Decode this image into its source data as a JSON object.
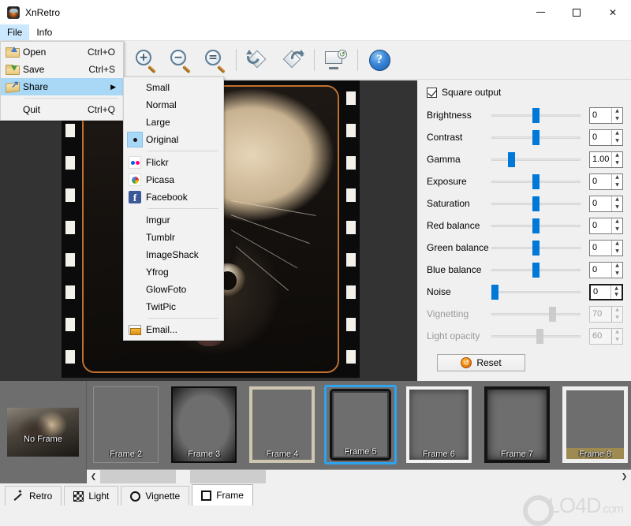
{
  "window": {
    "title": "XnRetro",
    "icon": "app-icon",
    "controls": {
      "minimize": "–",
      "maximize": "☐",
      "close": "✕"
    }
  },
  "menubar": {
    "items": [
      {
        "label": "File",
        "active": true
      },
      {
        "label": "Info",
        "active": false
      }
    ]
  },
  "file_menu": {
    "items": [
      {
        "label": "Open",
        "accel": "Ctrl+O",
        "icon": "folder-open-icon",
        "selected": false,
        "submenu": false
      },
      {
        "label": "Save",
        "accel": "Ctrl+S",
        "icon": "folder-save-icon",
        "selected": false,
        "submenu": false
      },
      {
        "label": "Share",
        "accel": "",
        "icon": "share-icon",
        "selected": true,
        "submenu": true,
        "arrow": "▶"
      },
      {
        "label": "Quit",
        "accel": "Ctrl+Q",
        "icon": "",
        "selected": false,
        "submenu": false
      }
    ]
  },
  "share_menu": {
    "sizes": [
      {
        "label": "Small",
        "checked": false
      },
      {
        "label": "Normal",
        "checked": false
      },
      {
        "label": "Large",
        "checked": false
      },
      {
        "label": "Original",
        "checked": true
      }
    ],
    "services_primary": [
      {
        "label": "Flickr",
        "icon": "flickr-icon"
      },
      {
        "label": "Picasa",
        "icon": "picasa-icon"
      },
      {
        "label": "Facebook",
        "icon": "facebook-icon"
      }
    ],
    "services_secondary": [
      {
        "label": "Imgur"
      },
      {
        "label": "Tumblr"
      },
      {
        "label": "ImageShack"
      },
      {
        "label": "Yfrog"
      },
      {
        "label": "GlowFoto"
      },
      {
        "label": "TwitPic"
      }
    ],
    "email": {
      "label": "Email...",
      "icon": "email-icon"
    }
  },
  "toolbar": {
    "buttons": [
      {
        "name": "zoom-in-icon",
        "symbol": "+"
      },
      {
        "name": "zoom-out-icon",
        "symbol": "−"
      },
      {
        "name": "zoom-fit-icon",
        "symbol": "="
      },
      {
        "name": "rotate-right-icon",
        "symbol": ""
      },
      {
        "name": "rotate-left-icon",
        "symbol": ""
      },
      {
        "name": "restore-view-icon",
        "symbol": "↺"
      },
      {
        "name": "help-icon",
        "symbol": "?"
      }
    ]
  },
  "panel": {
    "square_output": {
      "label": "Square output",
      "checked": true
    },
    "sliders": [
      {
        "label": "Brightness",
        "value": "0",
        "pos": 50,
        "enabled": true
      },
      {
        "label": "Contrast",
        "value": "0",
        "pos": 50,
        "enabled": true
      },
      {
        "label": "Gamma",
        "value": "1.00",
        "pos": 20,
        "enabled": true
      },
      {
        "label": "Exposure",
        "value": "0",
        "pos": 50,
        "enabled": true
      },
      {
        "label": "Saturation",
        "value": "0",
        "pos": 50,
        "enabled": true
      },
      {
        "label": "Red balance",
        "value": "0",
        "pos": 50,
        "enabled": true
      },
      {
        "label": "Green balance",
        "value": "0",
        "pos": 50,
        "enabled": true
      },
      {
        "label": "Blue balance",
        "value": "0",
        "pos": 50,
        "enabled": true
      },
      {
        "label": "Noise",
        "value": "0",
        "pos": 0,
        "enabled": true,
        "focused": true
      },
      {
        "label": "Vignetting",
        "value": "70",
        "pos": 70,
        "enabled": false
      },
      {
        "label": "Light opacity",
        "value": "60",
        "pos": 55,
        "enabled": false
      }
    ],
    "reset_button": {
      "label": "Reset",
      "icon": "reset-icon"
    },
    "spin_up": "▲",
    "spin_down": "▼"
  },
  "frames": {
    "no_frame": {
      "label": "No Frame",
      "selected": false
    },
    "items": [
      {
        "label": "Frame 2",
        "selected": false
      },
      {
        "label": "Frame 3",
        "selected": false
      },
      {
        "label": "Frame 4",
        "selected": false
      },
      {
        "label": "Frame 5",
        "selected": true
      },
      {
        "label": "Frame 6",
        "selected": false
      },
      {
        "label": "Frame 7",
        "selected": false
      },
      {
        "label": "Frame 8",
        "selected": false
      }
    ],
    "scrollbar": {
      "left_arrow": "❮",
      "right_arrow": "❯"
    }
  },
  "tabs": [
    {
      "label": "Retro",
      "icon": "magic-wand-icon",
      "active": false
    },
    {
      "label": "Light",
      "icon": "checker-icon",
      "active": false
    },
    {
      "label": "Vignette",
      "icon": "circle-icon",
      "active": false
    },
    {
      "label": "Frame",
      "icon": "square-icon",
      "active": true
    }
  ],
  "watermark": {
    "text": "LO4D",
    "suffix": ".com"
  },
  "colors": {
    "accent": "#0078d7",
    "selection": "#a9d8f7",
    "frame_border": "#c0712f",
    "strip_bg": "#6e6e6e"
  }
}
